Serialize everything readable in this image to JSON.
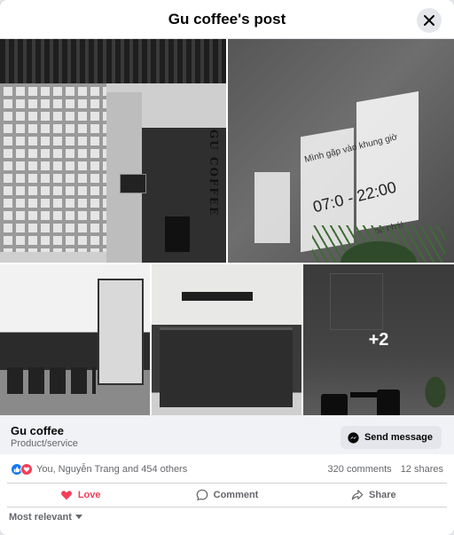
{
  "header": {
    "title": "Gu coffee's post"
  },
  "photos": {
    "overlay_count": "+2",
    "wall_text_line1": "Mình gặp        vào khung giờ",
    "wall_time": "07:0   - 22:00",
    "wall_text_line3": "ba nhé!",
    "storefront_vertical_text": "GU COFFEE"
  },
  "page": {
    "name": "Gu coffee",
    "category": "Product/service",
    "send_message_label": "Send message"
  },
  "stats": {
    "reactions_text": "You, Nguyễn Trang and 454 others",
    "comments": "320 comments",
    "shares": "12 shares"
  },
  "actions": {
    "love": "Love",
    "comment": "Comment",
    "share": "Share"
  },
  "sort": {
    "label": "Most relevant"
  },
  "colors": {
    "brand_blue": "#1877f2",
    "love_red": "#f33e58",
    "secondary_text": "#65676b"
  },
  "icons": [
    "close-icon",
    "messenger-icon",
    "like-reaction-icon",
    "love-reaction-icon",
    "heart-icon",
    "comment-icon",
    "share-icon",
    "chevron-down-icon"
  ]
}
